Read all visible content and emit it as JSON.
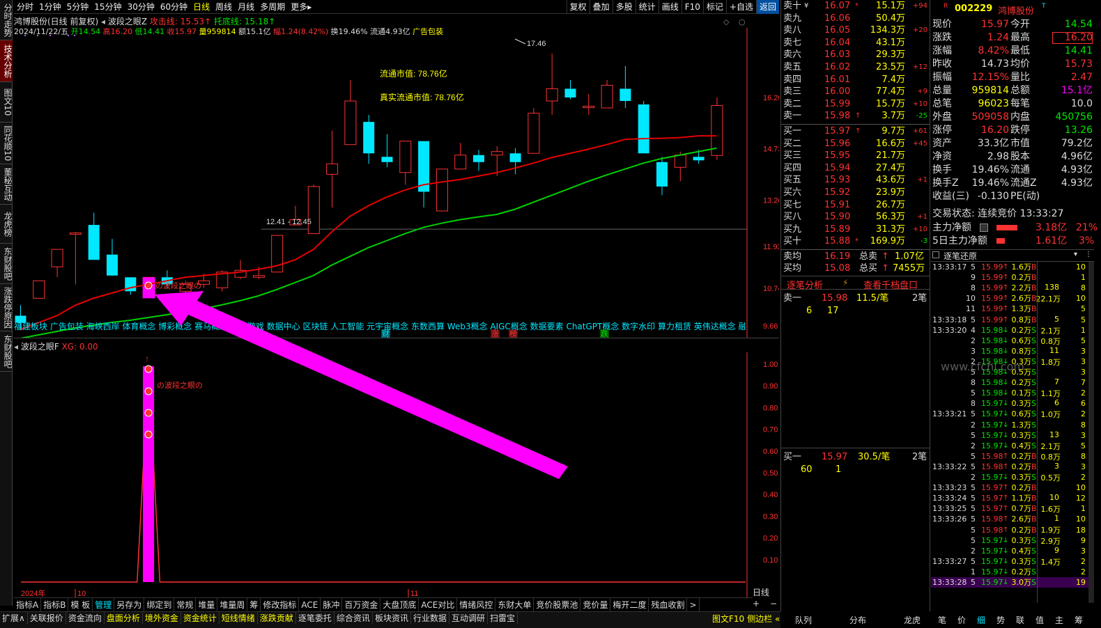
{
  "left_tabs": [
    "分时走势",
    "技术分析",
    "图文10",
    "同花顺10",
    "董秘互动",
    "龙虎榜",
    "东财股吧",
    "涨跌停原因",
    "东财股吧"
  ],
  "period_tabs": [
    "分时",
    "1分钟",
    "5分钟",
    "15分钟",
    "30分钟",
    "60分钟",
    "日线",
    "周线",
    "月线",
    "多周期",
    "更多▸"
  ],
  "period_selected": "日线",
  "right_tools": [
    "复权",
    "叠加",
    "多股",
    "统计",
    "画线",
    "F10",
    "标记",
    "+自选",
    "返回"
  ],
  "chart": {
    "title_stock": "鸿博股份(日线 前复权)",
    "indicator_name": "波段之眼Z",
    "attack_line": "攻击线: 15.53↑",
    "bottom_line": "托底线: 15.18↑",
    "info_line": {
      "date": "2024/11/22/五",
      "open": "开14.54",
      "high": "高16.20",
      "low": "低14.41",
      "close": "收15.97",
      "vol": "量959814",
      "amount": "额15.1亿",
      "change": "幅1.24(8.42%)",
      "turnover": "换19.46%",
      "float": "流通4.93亿",
      "concept": "广告包装"
    },
    "ann_float_mv": "流通市值: 78.76亿",
    "ann_real_float_mv": "真实流通市值: 78.76亿",
    "ann_high": "17.46",
    "ann_range": "12.41 - 12.45",
    "ann_eye": "の波段之眼の",
    "y_labels": [
      "16.20",
      "14.73",
      "13.26",
      "11.93",
      "10.74",
      "9.66"
    ],
    "concepts": "福建板块 广告包装 海峡西岸 体育概念 博彩概念 赛马概念 网络游戏 数据中心 区块链 人工智能 元宇宙概念 东数西算 Web3概念 AIGC概念 数据要素 ChatGPT概念 数字水印 算力租赁 英伟达概念 融资融券",
    "markers": [
      "财",
      "涨",
      "榜",
      "跌"
    ],
    "year_label": "2024年",
    "month_labels": [
      "10",
      "11"
    ]
  },
  "chart_data": {
    "type": "candlestick",
    "title": "鸿博股份(日线 前复权)",
    "candles": [
      {
        "o": 9.95,
        "h": 10.25,
        "l": 9.55,
        "c": 9.75
      },
      {
        "o": 10.45,
        "h": 10.95,
        "l": 10.45,
        "c": 10.95
      },
      {
        "o": 11.35,
        "h": 11.85,
        "l": 11.05,
        "c": 11.85
      },
      {
        "o": 12.32,
        "h": 12.35,
        "l": 10.85,
        "c": 12.32
      },
      {
        "o": 12.55,
        "h": 12.9,
        "l": 11.55,
        "c": 11.55
      },
      {
        "o": 11.7,
        "h": 12.15,
        "l": 11.1,
        "c": 11.1
      },
      {
        "o": 11.05,
        "h": 11.05,
        "l": 10.55,
        "c": 10.65
      },
      {
        "o": 10.55,
        "h": 11.05,
        "l": 10.45,
        "c": 11.05
      },
      {
        "o": 11.05,
        "h": 11.25,
        "l": 10.75,
        "c": 10.85
      },
      {
        "o": 10.65,
        "h": 10.95,
        "l": 10.55,
        "c": 10.85
      },
      {
        "o": 10.85,
        "h": 11.15,
        "l": 10.75,
        "c": 10.95
      },
      {
        "o": 10.75,
        "h": 11.25,
        "l": 10.65,
        "c": 11.2
      },
      {
        "o": 11.05,
        "h": 11.55,
        "l": 11.0,
        "c": 11.25
      },
      {
        "o": 11.05,
        "h": 11.35,
        "l": 11.0,
        "c": 11.1
      },
      {
        "o": 11.2,
        "h": 12.25,
        "l": 11.2,
        "c": 12.25
      },
      {
        "o": 12.55,
        "h": 13.1,
        "l": 12.55,
        "c": 12.7
      },
      {
        "o": 12.3,
        "h": 13.7,
        "l": 12.3,
        "c": 13.65
      },
      {
        "o": 14.0,
        "h": 15.25,
        "l": 13.05,
        "c": 14.3
      },
      {
        "o": 14.85,
        "h": 16.7,
        "l": 14.85,
        "c": 16.1
      },
      {
        "o": 15.5,
        "h": 15.7,
        "l": 14.3,
        "c": 14.6
      },
      {
        "o": 14.5,
        "h": 15.15,
        "l": 14.2,
        "c": 14.35
      },
      {
        "o": 14.05,
        "h": 14.9,
        "l": 13.7,
        "c": 14.95
      },
      {
        "o": 14.95,
        "h": 14.95,
        "l": 13.05,
        "c": 13.5
      },
      {
        "o": 12.95,
        "h": 14.1,
        "l": 12.95,
        "c": 14.15
      },
      {
        "o": 14.15,
        "h": 14.9,
        "l": 14.3,
        "c": 14.55
      },
      {
        "o": 14.55,
        "h": 14.7,
        "l": 14.1,
        "c": 14.35
      },
      {
        "o": 14.55,
        "h": 14.8,
        "l": 13.95,
        "c": 14.65
      },
      {
        "o": 14.6,
        "h": 14.75,
        "l": 14.0,
        "c": 14.35
      },
      {
        "o": 14.6,
        "h": 15.9,
        "l": 14.6,
        "c": 15.75
      },
      {
        "o": 16.1,
        "h": 17.46,
        "l": 15.7,
        "c": 16.45
      },
      {
        "o": 16.45,
        "h": 16.7,
        "l": 16.15,
        "c": 16.2
      },
      {
        "o": 15.95,
        "h": 16.3,
        "l": 15.7,
        "c": 15.95
      },
      {
        "o": 15.9,
        "h": 16.7,
        "l": 15.9,
        "c": 16.55
      },
      {
        "o": 16.45,
        "h": 17.1,
        "l": 15.9,
        "c": 16.1
      },
      {
        "o": 16.0,
        "h": 16.1,
        "l": 14.6,
        "c": 14.6
      },
      {
        "o": 14.35,
        "h": 14.5,
        "l": 13.4,
        "c": 13.65
      },
      {
        "o": 14.2,
        "h": 14.65,
        "l": 13.8,
        "c": 14.55
      },
      {
        "o": 14.5,
        "h": 14.7,
        "l": 14.3,
        "c": 14.4
      },
      {
        "o": 14.54,
        "h": 16.2,
        "l": 14.41,
        "c": 15.97
      }
    ],
    "attack_line": [
      9.55,
      9.75,
      9.95,
      10.25,
      10.45,
      10.6,
      10.75,
      10.85,
      10.95,
      11.05,
      11.1,
      11.15,
      11.2,
      11.28,
      11.38,
      11.55,
      11.85,
      12.35,
      12.8,
      13.1,
      13.35,
      13.55,
      13.7,
      13.78,
      13.85,
      13.95,
      14.05,
      14.18,
      14.32,
      14.48,
      14.6,
      14.72,
      14.85,
      15.0,
      15.02,
      15.03,
      15.05,
      15.1,
      15.1
    ],
    "bottom_line": [
      9.3,
      9.4,
      9.5,
      9.6,
      9.68,
      9.76,
      9.82,
      9.9,
      9.98,
      10.06,
      10.15,
      10.26,
      10.38,
      10.52,
      10.7,
      10.9,
      11.1,
      11.4,
      11.65,
      11.9,
      12.1,
      12.3,
      12.48,
      12.6,
      12.7,
      12.78,
      12.85,
      13.0,
      13.2,
      13.4,
      13.6,
      13.8,
      13.98,
      14.15,
      14.32,
      14.45,
      14.55,
      14.65,
      14.75
    ],
    "indicator_f": {
      "name": "波段之眼F",
      "xg": "XG: 0.00",
      "values": [
        0,
        0,
        0,
        0,
        0,
        0,
        0,
        1,
        0,
        0,
        0,
        0,
        0,
        0,
        0,
        0,
        0,
        0,
        0,
        0,
        0,
        0,
        0,
        0,
        0,
        0,
        0,
        0,
        0,
        0,
        0,
        0,
        0,
        0,
        0,
        0,
        0,
        0,
        0
      ],
      "ylim": [
        0,
        1
      ],
      "y_labels": [
        "1.00",
        "0.90",
        "0.80",
        "0.70",
        "0.60",
        "0.50",
        "0.40",
        "0.30",
        "0.20",
        "0.10"
      ]
    }
  },
  "orderbook": {
    "sells": [
      {
        "lbl": "卖十",
        "flag": "¥",
        "price": "16.07",
        "arrow": "*",
        "vol": "15.1万",
        "chg": "+94"
      },
      {
        "lbl": "卖九",
        "flag": "",
        "price": "16.06",
        "arrow": "",
        "vol": "50.4万",
        "chg": ""
      },
      {
        "lbl": "卖八",
        "flag": "",
        "price": "16.05",
        "arrow": "",
        "vol": "134.3万",
        "chg": "+20"
      },
      {
        "lbl": "卖七",
        "flag": "",
        "price": "16.04",
        "arrow": "",
        "vol": "43.1万",
        "chg": ""
      },
      {
        "lbl": "卖六",
        "flag": "",
        "price": "16.03",
        "arrow": "",
        "vol": "29.3万",
        "chg": ""
      },
      {
        "lbl": "卖五",
        "flag": "",
        "price": "16.02",
        "arrow": "",
        "vol": "23.5万",
        "chg": "+12"
      },
      {
        "lbl": "卖四",
        "flag": "",
        "price": "16.01",
        "arrow": "",
        "vol": "7.4万",
        "chg": ""
      },
      {
        "lbl": "卖三",
        "flag": "",
        "price": "16.00",
        "arrow": "",
        "vol": "77.4万",
        "chg": "+9"
      },
      {
        "lbl": "卖二",
        "flag": "",
        "price": "15.99",
        "arrow": "",
        "vol": "15.7万",
        "chg": "+10"
      },
      {
        "lbl": "卖一",
        "flag": "",
        "price": "15.98",
        "arrow": "↑",
        "vol": "3.7万",
        "chg": "-25"
      }
    ],
    "buys": [
      {
        "lbl": "买一",
        "price": "15.97",
        "arrow": "↑",
        "vol": "9.7万",
        "chg": "+61"
      },
      {
        "lbl": "买二",
        "price": "15.96",
        "arrow": "",
        "vol": "16.6万",
        "chg": "+45"
      },
      {
        "lbl": "买三",
        "price": "15.95",
        "arrow": "",
        "vol": "21.7万",
        "chg": ""
      },
      {
        "lbl": "买四",
        "price": "15.94",
        "arrow": "",
        "vol": "27.4万",
        "chg": ""
      },
      {
        "lbl": "买五",
        "price": "15.93",
        "arrow": "",
        "vol": "43.6万",
        "chg": "+1"
      },
      {
        "lbl": "买六",
        "price": "15.92",
        "arrow": "",
        "vol": "23.9万",
        "chg": ""
      },
      {
        "lbl": "买七",
        "price": "15.91",
        "arrow": "",
        "vol": "26.7万",
        "chg": ""
      },
      {
        "lbl": "买八",
        "price": "15.90",
        "arrow": "",
        "vol": "56.3万",
        "chg": "+1"
      },
      {
        "lbl": "买九",
        "price": "15.89",
        "arrow": "",
        "vol": "31.3万",
        "chg": "+10"
      },
      {
        "lbl": "买十",
        "price": "15.88",
        "arrow": "*",
        "vol": "169.9万",
        "chg": "-3"
      }
    ],
    "sell_avg": {
      "label": "卖均",
      "price": "16.19",
      "total_label": "总卖",
      "arrow": "↑",
      "total": "1.07亿"
    },
    "buy_avg": {
      "label": "买均",
      "price": "15.08",
      "total_label": "总买",
      "arrow": "↑",
      "total": "7455万"
    },
    "tab_analysis": "逐笔分析",
    "tab_view10": "查看千档盘口",
    "sell1_detail": {
      "label": "卖一",
      "price": "15.98",
      "qty": "11.5/笔",
      "count": "2笔",
      "q1": "6",
      "q2": "17"
    },
    "buy1_detail": {
      "label": "买一",
      "price": "15.97",
      "qty": "30.5/笔",
      "count": "2笔",
      "q1": "60",
      "q2": "1"
    }
  },
  "quote": {
    "code": "002229",
    "name": "鸿博股份",
    "r": "R",
    "t": "T",
    "rows": [
      [
        "现价",
        "15.97",
        "今开",
        "14.54"
      ],
      [
        "涨跌",
        "1.24",
        "最高",
        "16.20"
      ],
      [
        "涨幅",
        "8.42%",
        "最低",
        "14.41"
      ],
      [
        "昨收",
        "14.73",
        "均价",
        "15.73"
      ],
      [
        "振幅",
        "12.15%",
        "量比",
        "2.47"
      ],
      [
        "总量",
        "959814",
        "总额",
        "15.1亿"
      ],
      [
        "总笔",
        "96023",
        "每笔",
        "10.0"
      ],
      [
        "外盘",
        "509058",
        "内盘",
        "450756"
      ],
      [
        "涨停",
        "16.20",
        "跌停",
        "13.26"
      ],
      [
        "资产",
        "33.3亿",
        "市值",
        "79.2亿"
      ],
      [
        "净资",
        "2.98",
        "股本",
        "4.96亿"
      ],
      [
        "换手",
        "19.46%",
        "流通",
        "4.93亿"
      ],
      [
        "换手Z",
        "19.46%",
        "流通Z",
        "4.93亿"
      ],
      [
        "收益(三)",
        "-0.130",
        "PE(动)",
        ""
      ]
    ],
    "trade_state": "交易状态: 连续竞价 13:33:27",
    "main_net": {
      "label": "主力净额",
      "value": "3.18亿",
      "pct": "21%"
    },
    "main_net5": {
      "label": "5日主力净额",
      "value": "1.61亿",
      "pct": "3%"
    },
    "ticks_title": "逐笔还原",
    "watermark": "www.cfchi.com"
  },
  "ticks": [
    {
      "t": "13:33:17",
      "n": "5",
      "p": "15.99",
      "v": "1.6万",
      "d": "B",
      "s": "10"
    },
    {
      "t": "",
      "n": "9",
      "p": "15.99",
      "v": "0.2万",
      "d": "B",
      "s": "1"
    },
    {
      "t": "",
      "n": "8",
      "p": "15.99",
      "v": "2.2万",
      "d": "B",
      "s": "8"
    },
    {
      "t": "",
      "n": "10",
      "p": "15.99",
      "v": "2.6万",
      "d": "B",
      "s": "10"
    },
    {
      "t": "",
      "n": "11",
      "p": "15.99",
      "v": "1.3万",
      "d": "B",
      "s": "5"
    },
    {
      "t": "13:33:18",
      "n": "5",
      "p": "15.99",
      "v": "0.8万",
      "d": "B",
      "s": "5"
    },
    {
      "t": "13:33:20",
      "n": "4",
      "p": "15.98",
      "v": "0.2万",
      "d": "S",
      "s": "1"
    },
    {
      "t": "",
      "n": "2",
      "p": "15.98",
      "v": "0.6万",
      "d": "S",
      "s": "5"
    },
    {
      "t": "",
      "n": "3",
      "p": "15.98",
      "v": "0.8万",
      "d": "S",
      "s": "3"
    },
    {
      "t": "",
      "n": "2",
      "p": "15.98",
      "v": "0.3万",
      "d": "S",
      "s": "3"
    },
    {
      "t": "",
      "n": "5",
      "p": "15.98",
      "v": "0.5万",
      "d": "S",
      "s": "3"
    },
    {
      "t": "",
      "n": "8",
      "p": "15.98",
      "v": "0.2万",
      "d": "S",
      "s": "7"
    },
    {
      "t": "",
      "n": "5",
      "p": "15.98",
      "v": "0.1万",
      "d": "S",
      "s": "2"
    },
    {
      "t": "",
      "n": "8",
      "p": "15.97",
      "v": "0.3万",
      "d": "S",
      "s": "6"
    },
    {
      "t": "13:33:21",
      "n": "5",
      "p": "15.97",
      "v": "0.6万",
      "d": "S",
      "s": "2"
    },
    {
      "t": "",
      "n": "2",
      "p": "15.97",
      "v": "1.3万",
      "d": "S",
      "s": "8"
    },
    {
      "t": "",
      "n": "5",
      "p": "15.97",
      "v": "0.3万",
      "d": "S",
      "s": "3"
    },
    {
      "t": "",
      "n": "2",
      "p": "15.97",
      "v": "0.4万",
      "d": "S",
      "s": "5"
    },
    {
      "t": "",
      "n": "5",
      "p": "15.98",
      "v": "0.2万",
      "d": "B",
      "s": "8"
    },
    {
      "t": "13:33:22",
      "n": "5",
      "p": "15.98",
      "v": "0.2万",
      "d": "B",
      "s": "3"
    },
    {
      "t": "",
      "n": "2",
      "p": "15.97",
      "v": "0.3万",
      "d": "S",
      "s": "2"
    },
    {
      "t": "13:33:23",
      "n": "5",
      "p": "15.97",
      "v": "0.2万",
      "d": "B",
      "s": "10"
    },
    {
      "t": "13:33:24",
      "n": "5",
      "p": "15.97",
      "v": "1.1万",
      "d": "B",
      "s": "12"
    },
    {
      "t": "13:33:25",
      "n": "5",
      "p": "15.97",
      "v": "0.7万",
      "d": "B",
      "s": "1"
    },
    {
      "t": "13:33:26",
      "n": "5",
      "p": "15.98",
      "v": "2.6万",
      "d": "B",
      "s": "10"
    },
    {
      "t": "",
      "n": "5",
      "p": "15.98",
      "v": "0.2万",
      "d": "B",
      "s": "18"
    },
    {
      "t": "",
      "n": "5",
      "p": "15.97",
      "v": "0.3万",
      "d": "S",
      "s": "9"
    },
    {
      "t": "",
      "n": "2",
      "p": "15.97",
      "v": "0.4万",
      "d": "S",
      "s": "3"
    },
    {
      "t": "13:33:27",
      "n": "5",
      "p": "15.97",
      "v": "0.3万",
      "d": "S",
      "s": "2"
    },
    {
      "t": "",
      "n": "1",
      "p": "15.97",
      "v": "0.2万",
      "d": "S",
      "s": "2"
    },
    {
      "t": "13:33:28",
      "n": "5",
      "p": "15.97",
      "v": "3.0万",
      "d": "S",
      "s": "19",
      "hl": true
    }
  ],
  "tick_aggregates": [
    {
      "row": 2,
      "a": "138",
      "b": "22.1万"
    },
    {
      "row": 5,
      "a": "5",
      "b": "2.1万"
    },
    {
      "row": 7,
      "a": "",
      "b": "0.8万"
    },
    {
      "row": 8,
      "a": "11",
      "b": ""
    },
    {
      "row": 9,
      "a": "",
      "b": "1.8万"
    },
    {
      "row": 11,
      "a": "7",
      "b": "1.1万"
    },
    {
      "row": 13,
      "a": "6",
      "b": ""
    },
    {
      "row": 14,
      "a": "",
      "b": "1.0万"
    },
    {
      "row": 16,
      "a": "13",
      "b": "2.1万"
    },
    {
      "row": 18,
      "a": "",
      "b": "0.8万"
    },
    {
      "row": 19,
      "a": "3",
      "b": "0.5万"
    },
    {
      "row": 22,
      "a": "10",
      "b": "1.6万"
    },
    {
      "row": 24,
      "a": "1",
      "b": "1.9万"
    },
    {
      "row": 26,
      "a": "",
      "b": "2.9万"
    },
    {
      "row": 27,
      "a": "9",
      "b": "1.4万"
    }
  ],
  "bottom_tabs": [
    "指标A",
    "指标B",
    "模 板",
    "管理",
    "另存为",
    "绑定到",
    "常规",
    "堆量",
    "堆量周",
    "筹",
    "修改指标",
    "ACE",
    "脉冲",
    "百万资金",
    "大盘顶底",
    "ACE对比",
    "情绪风控",
    "东财大单",
    "竞价股票池",
    "竞价量",
    "梅开二度",
    "残血收割",
    ">"
  ],
  "bottom_tab_selected": "管理",
  "status_tabs": [
    "扩展∧",
    "关联报价",
    "资金流向",
    "盘面分析",
    "境外资金",
    "资金统计",
    "短线情绪",
    "涨跌贡献",
    "逐笔委托",
    "综合资讯",
    "板块资讯",
    "行业数据",
    "互动调研",
    "扫雷宝"
  ],
  "status_right": [
    "图文F10",
    "侧边栏 «"
  ],
  "bottom_mid_tabs": [
    "队列",
    "分布",
    "龙虎"
  ],
  "bottom_right_tabs": [
    "笔",
    "价",
    "细",
    "势",
    "联",
    "值",
    "主",
    "筹"
  ],
  "bottom_right_selected": "细",
  "period_label": "日线",
  "colors": {
    "up": "#ff3232",
    "down": "#00e8ff",
    "attack": "#e60000",
    "bottom": "#00d000",
    "arrow": "#ff00ff"
  }
}
